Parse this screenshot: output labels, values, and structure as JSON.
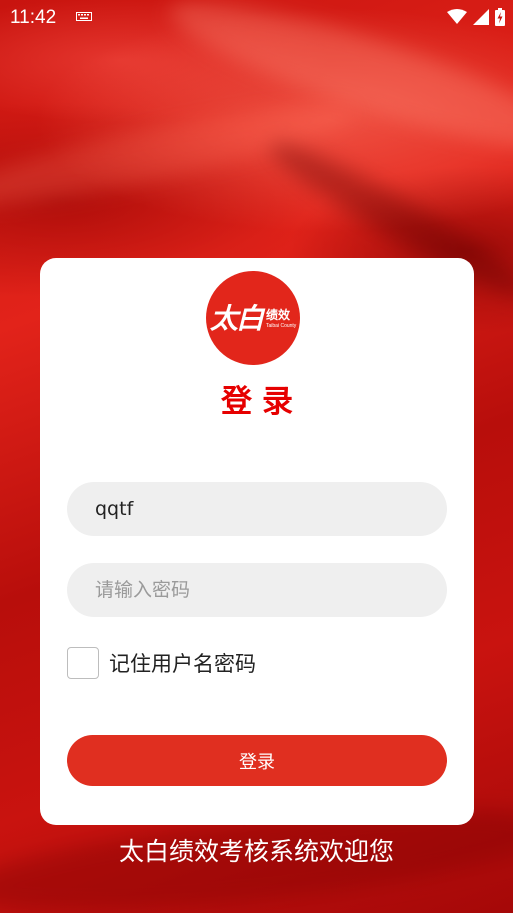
{
  "status_bar": {
    "time": "11:42",
    "icons": [
      "keyboard-icon",
      "wifi-icon",
      "signal-icon",
      "battery-charging-icon"
    ]
  },
  "logo": {
    "main_text": "太白",
    "side_text": "绩效",
    "sub_text": "Taibai County"
  },
  "login": {
    "title": "登录",
    "username_value": "qqtf",
    "password_placeholder": "请输入密码",
    "remember_label": "记住用户名密码",
    "remember_checked": false,
    "submit_label": "登录"
  },
  "welcome_text": "太白绩效考核系统欢迎您",
  "colors": {
    "accent_red": "#e60000",
    "button_red": "#e02f20",
    "logo_red": "#e2261b",
    "field_bg": "#efefef"
  }
}
